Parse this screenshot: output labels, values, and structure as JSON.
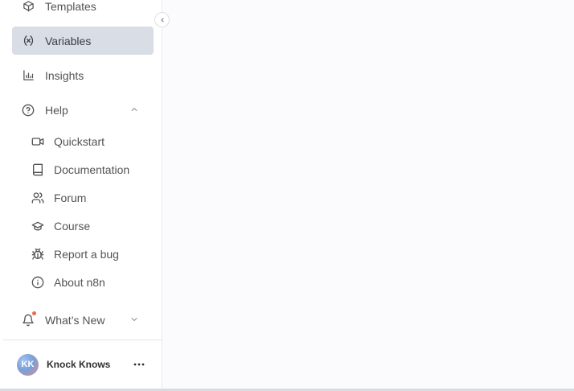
{
  "sidebar": {
    "items": [
      {
        "label": "Templates",
        "icon": "box-icon"
      },
      {
        "label": "Variables",
        "icon": "variables-icon",
        "active": true
      },
      {
        "label": "Insights",
        "icon": "bar-chart-icon"
      },
      {
        "label": "Help",
        "icon": "help-circle-icon",
        "expanded": true
      }
    ],
    "help_items": [
      {
        "label": "Quickstart",
        "icon": "video-icon"
      },
      {
        "label": "Documentation",
        "icon": "book-icon"
      },
      {
        "label": "Forum",
        "icon": "users-icon"
      },
      {
        "label": "Course",
        "icon": "graduation-cap-icon"
      },
      {
        "label": "Report a bug",
        "icon": "bug-icon"
      },
      {
        "label": "About n8n",
        "icon": "info-icon"
      }
    ],
    "whats_new": {
      "label": "What’s New",
      "icon": "bell-icon"
    },
    "user": {
      "initials": "KK",
      "name": "Knock Knows"
    }
  },
  "colors": {
    "active_bg": "#d9dde6",
    "notification_dot": "#ea6a4f",
    "text": "#525356"
  }
}
